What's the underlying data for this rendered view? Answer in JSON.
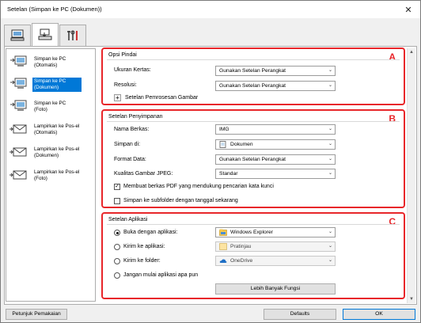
{
  "window": {
    "title": "Setelan (Simpan ke PC (Dokumen))",
    "close_glyph": "✕"
  },
  "tabs": [
    {
      "name": "scan-from-computer-icon"
    },
    {
      "name": "scan-from-operation-panel-icon"
    },
    {
      "name": "general-settings-icon"
    }
  ],
  "sidebar": {
    "items": [
      {
        "label": "Simpan ke PC (Otomatis)",
        "icon": "save-to-pc-icon"
      },
      {
        "label": "Simpan ke PC (Dokumen)",
        "icon": "save-to-pc-icon"
      },
      {
        "label": "Simpan ke PC (Foto)",
        "icon": "save-to-pc-icon"
      },
      {
        "label": "Lampirkan ke Pos-el (Otomatis)",
        "icon": "email-icon"
      },
      {
        "label": "Lampirkan ke Pos-el (Dokumen)",
        "icon": "email-icon"
      },
      {
        "label": "Lampirkan ke Pos-el (Foto)",
        "icon": "email-icon"
      }
    ]
  },
  "scan_options": {
    "header": "Opsi Pindai",
    "letter": "A",
    "paper_size_label": "Ukuran Kertas:",
    "paper_size_value": "Gunakan Setelan Perangkat",
    "resolution_label": "Resolusi:",
    "resolution_value": "Gunakan Setelan Perangkat",
    "image_processing_label": "Setelan Pemrosesan Gambar",
    "plus": "+"
  },
  "save_settings": {
    "header": "Setelan Penyimpanan",
    "letter": "B",
    "file_name_label": "Nama Berkas:",
    "file_name_value": "IMG",
    "save_in_label": "Simpan di:",
    "save_in_value": "Dokumen",
    "data_format_label": "Format Data:",
    "data_format_value": "Gunakan Setelan Perangkat",
    "jpeg_quality_label": "Kualitas Gambar JPEG:",
    "jpeg_quality_value": "Standar",
    "pdf_keyword_label": "Membuat berkas PDF yang mendukung pencarian kata kunci",
    "pdf_keyword_checked": true,
    "subfolder_label": "Simpan ke subfolder dengan tanggal sekarang",
    "subfolder_checked": false
  },
  "app_settings": {
    "header": "Setelan Aplikasi",
    "letter": "C",
    "open_with_label": "Buka dengan aplikasi:",
    "open_with_value": "Windows Explorer",
    "send_to_app_label": "Kirim ke aplikasi:",
    "send_to_app_value": "Pratinjau",
    "send_to_folder_label": "Kirim ke folder:",
    "send_to_folder_value": "OneDrive",
    "do_not_start_label": "Jangan mulai aplikasi apa pun",
    "more_functions_label": "Lebih Banyak Fungsi",
    "selected_option": "open_with"
  },
  "footer": {
    "instructions_label": "Petunjuk Pemakaian",
    "defaults_label": "Defaults",
    "ok_label": "OK"
  },
  "colors": {
    "highlight": "#e8262a",
    "selection": "#0078d7"
  }
}
